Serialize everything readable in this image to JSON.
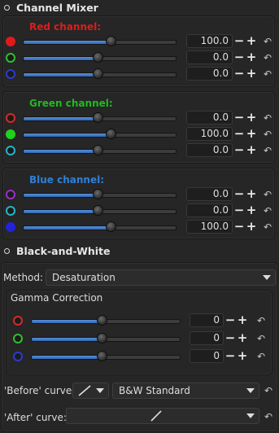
{
  "channel_mixer": {
    "title": "Channel Mixer",
    "red": {
      "label": "Red channel:",
      "color": "#d81e1e",
      "rows": [
        {
          "dot": "red-filled",
          "value": "100.0",
          "fraction": 0.58
        },
        {
          "dot": "green-ring",
          "value": "0.0",
          "fraction": 0.49
        },
        {
          "dot": "blue-ring",
          "value": "0.0",
          "fraction": 0.49
        }
      ]
    },
    "green": {
      "label": "Green channel:",
      "color": "#1fba1f",
      "rows": [
        {
          "dot": "red-ring",
          "value": "0.0",
          "fraction": 0.49
        },
        {
          "dot": "green-filled",
          "value": "100.0",
          "fraction": 0.58
        },
        {
          "dot": "cyan-ring",
          "value": "0.0",
          "fraction": 0.49
        }
      ]
    },
    "blue": {
      "label": "Blue channel:",
      "color": "#2f7fd8",
      "rows": [
        {
          "dot": "purple-ring",
          "value": "0.0",
          "fraction": 0.49
        },
        {
          "dot": "cyan-ring",
          "value": "0.0",
          "fraction": 0.49
        },
        {
          "dot": "blue-filled",
          "value": "100.0",
          "fraction": 0.58
        }
      ]
    }
  },
  "black_and_white": {
    "title": "Black-and-White",
    "method_label": "Method:",
    "method_value": "Desaturation",
    "gamma": {
      "title": "Gamma Correction",
      "rows": [
        {
          "dot": "red-ring",
          "value": "0",
          "fraction": 0.48
        },
        {
          "dot": "green-ring",
          "value": "0",
          "fraction": 0.48
        },
        {
          "dot": "blue-ring",
          "value": "0",
          "fraction": 0.48
        }
      ]
    },
    "before_curve_label": "'Before' curve:",
    "before_curve_value": "B&W Standard",
    "after_curve_label": "'After' curve:"
  },
  "controls": {
    "minus": "−",
    "plus": "+",
    "reset_icon": "↶"
  },
  "colors": {
    "accent": "#2d69b8",
    "background": "#262626"
  }
}
